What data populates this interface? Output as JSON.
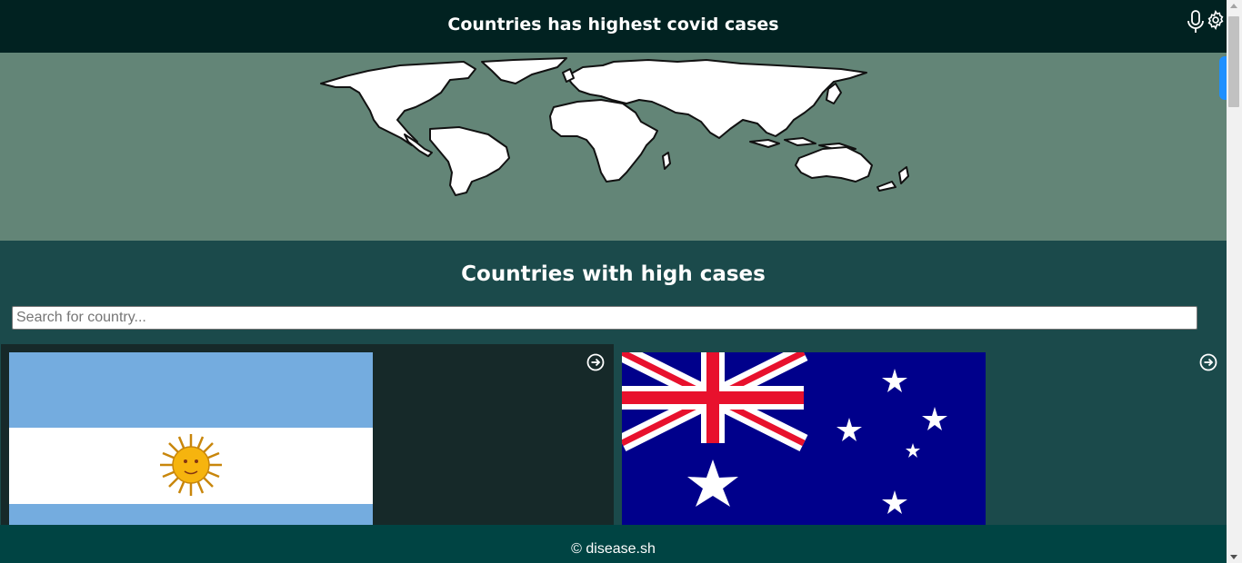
{
  "header": {
    "title": "Countries has highest covid cases",
    "icons": [
      "mic-icon",
      "gear-icon"
    ]
  },
  "hero": {
    "image": "world-map"
  },
  "section": {
    "title": "Countries with high cases",
    "search": {
      "placeholder": "Search for country...",
      "value": ""
    }
  },
  "cards": [
    {
      "flag": "argentina-flag",
      "name": "",
      "icon": "arrow-circle-right-icon"
    },
    {
      "flag": "australia-flag",
      "name": "",
      "icon": "arrow-circle-right-icon"
    }
  ],
  "footer": {
    "text": "© disease.sh"
  },
  "colors": {
    "header_bg": "#012221",
    "hero_bg": "#638577",
    "section_bg": "#1b4a4b",
    "card_active_bg": "#162929",
    "footer_bg": "#004443",
    "accent_tab": "#1e90ff"
  }
}
